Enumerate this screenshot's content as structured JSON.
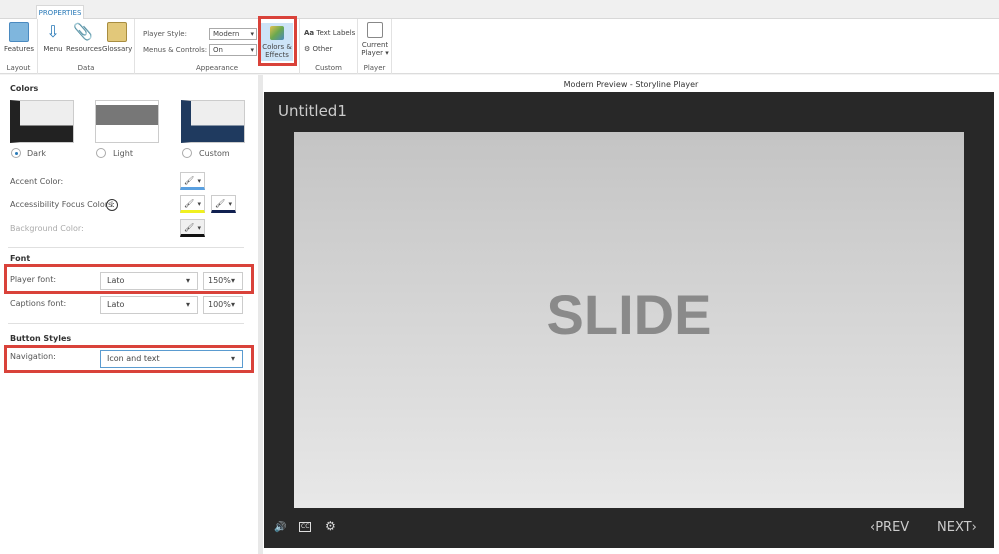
{
  "ribbon": {
    "tab": "PROPERTIES",
    "layout": {
      "label": "Layout",
      "features": "Features"
    },
    "data": {
      "label": "Data",
      "menu": "Menu",
      "resources": "Resources",
      "glossary": "Glossary"
    },
    "appearance": {
      "label": "Appearance",
      "player_style_label": "Player Style:",
      "player_style_value": "Modern",
      "menus_label": "Menus & Controls:",
      "menus_value": "On",
      "colors_effects": "Colors & Effects"
    },
    "custom": {
      "label": "Custom",
      "text_labels": "Text Labels",
      "other": "Other"
    },
    "player": {
      "label": "Player",
      "current_player": "Current Player"
    }
  },
  "panel": {
    "colors_heading": "Colors",
    "themes": [
      {
        "label": "Dark",
        "selected": true
      },
      {
        "label": "Light",
        "selected": false
      },
      {
        "label": "Custom",
        "selected": false
      }
    ],
    "accent_label": "Accent Color:",
    "focus_label": "Accessibility Focus Colors:",
    "background_label": "Background Color:",
    "font_heading": "Font",
    "player_font_label": "Player font:",
    "player_font": "Lato",
    "player_font_size": "150%",
    "captions_font_label": "Captions font:",
    "captions_font": "Lato",
    "captions_font_size": "100%",
    "button_heading": "Button Styles",
    "navigation_label": "Navigation:",
    "navigation_value": "Icon and text"
  },
  "preview": {
    "title": "Modern Preview - Storyline Player",
    "course_title": "Untitled1",
    "slide_text": "SLIDE",
    "prev": "PREV",
    "next": "NEXT",
    "cc": "CC"
  },
  "colors": {
    "accent": "#2a7ab8",
    "highlight": "#d9423a",
    "player_bg": "#282828"
  }
}
